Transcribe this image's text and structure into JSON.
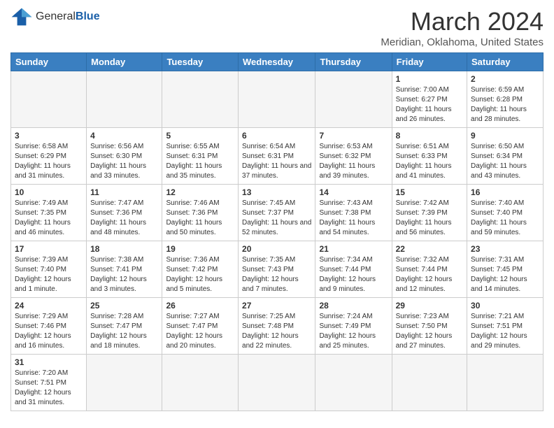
{
  "header": {
    "logo_general": "General",
    "logo_blue": "Blue",
    "month_title": "March 2024",
    "location": "Meridian, Oklahoma, United States"
  },
  "weekdays": [
    "Sunday",
    "Monday",
    "Tuesday",
    "Wednesday",
    "Thursday",
    "Friday",
    "Saturday"
  ],
  "weeks": [
    [
      {
        "day": "",
        "info": ""
      },
      {
        "day": "",
        "info": ""
      },
      {
        "day": "",
        "info": ""
      },
      {
        "day": "",
        "info": ""
      },
      {
        "day": "",
        "info": ""
      },
      {
        "day": "1",
        "info": "Sunrise: 7:00 AM\nSunset: 6:27 PM\nDaylight: 11 hours and 26 minutes."
      },
      {
        "day": "2",
        "info": "Sunrise: 6:59 AM\nSunset: 6:28 PM\nDaylight: 11 hours and 28 minutes."
      }
    ],
    [
      {
        "day": "3",
        "info": "Sunrise: 6:58 AM\nSunset: 6:29 PM\nDaylight: 11 hours and 31 minutes."
      },
      {
        "day": "4",
        "info": "Sunrise: 6:56 AM\nSunset: 6:30 PM\nDaylight: 11 hours and 33 minutes."
      },
      {
        "day": "5",
        "info": "Sunrise: 6:55 AM\nSunset: 6:31 PM\nDaylight: 11 hours and 35 minutes."
      },
      {
        "day": "6",
        "info": "Sunrise: 6:54 AM\nSunset: 6:31 PM\nDaylight: 11 hours and 37 minutes."
      },
      {
        "day": "7",
        "info": "Sunrise: 6:53 AM\nSunset: 6:32 PM\nDaylight: 11 hours and 39 minutes."
      },
      {
        "day": "8",
        "info": "Sunrise: 6:51 AM\nSunset: 6:33 PM\nDaylight: 11 hours and 41 minutes."
      },
      {
        "day": "9",
        "info": "Sunrise: 6:50 AM\nSunset: 6:34 PM\nDaylight: 11 hours and 43 minutes."
      }
    ],
    [
      {
        "day": "10",
        "info": "Sunrise: 7:49 AM\nSunset: 7:35 PM\nDaylight: 11 hours and 46 minutes."
      },
      {
        "day": "11",
        "info": "Sunrise: 7:47 AM\nSunset: 7:36 PM\nDaylight: 11 hours and 48 minutes."
      },
      {
        "day": "12",
        "info": "Sunrise: 7:46 AM\nSunset: 7:36 PM\nDaylight: 11 hours and 50 minutes."
      },
      {
        "day": "13",
        "info": "Sunrise: 7:45 AM\nSunset: 7:37 PM\nDaylight: 11 hours and 52 minutes."
      },
      {
        "day": "14",
        "info": "Sunrise: 7:43 AM\nSunset: 7:38 PM\nDaylight: 11 hours and 54 minutes."
      },
      {
        "day": "15",
        "info": "Sunrise: 7:42 AM\nSunset: 7:39 PM\nDaylight: 11 hours and 56 minutes."
      },
      {
        "day": "16",
        "info": "Sunrise: 7:40 AM\nSunset: 7:40 PM\nDaylight: 11 hours and 59 minutes."
      }
    ],
    [
      {
        "day": "17",
        "info": "Sunrise: 7:39 AM\nSunset: 7:40 PM\nDaylight: 12 hours and 1 minute."
      },
      {
        "day": "18",
        "info": "Sunrise: 7:38 AM\nSunset: 7:41 PM\nDaylight: 12 hours and 3 minutes."
      },
      {
        "day": "19",
        "info": "Sunrise: 7:36 AM\nSunset: 7:42 PM\nDaylight: 12 hours and 5 minutes."
      },
      {
        "day": "20",
        "info": "Sunrise: 7:35 AM\nSunset: 7:43 PM\nDaylight: 12 hours and 7 minutes."
      },
      {
        "day": "21",
        "info": "Sunrise: 7:34 AM\nSunset: 7:44 PM\nDaylight: 12 hours and 9 minutes."
      },
      {
        "day": "22",
        "info": "Sunrise: 7:32 AM\nSunset: 7:44 PM\nDaylight: 12 hours and 12 minutes."
      },
      {
        "day": "23",
        "info": "Sunrise: 7:31 AM\nSunset: 7:45 PM\nDaylight: 12 hours and 14 minutes."
      }
    ],
    [
      {
        "day": "24",
        "info": "Sunrise: 7:29 AM\nSunset: 7:46 PM\nDaylight: 12 hours and 16 minutes."
      },
      {
        "day": "25",
        "info": "Sunrise: 7:28 AM\nSunset: 7:47 PM\nDaylight: 12 hours and 18 minutes."
      },
      {
        "day": "26",
        "info": "Sunrise: 7:27 AM\nSunset: 7:47 PM\nDaylight: 12 hours and 20 minutes."
      },
      {
        "day": "27",
        "info": "Sunrise: 7:25 AM\nSunset: 7:48 PM\nDaylight: 12 hours and 22 minutes."
      },
      {
        "day": "28",
        "info": "Sunrise: 7:24 AM\nSunset: 7:49 PM\nDaylight: 12 hours and 25 minutes."
      },
      {
        "day": "29",
        "info": "Sunrise: 7:23 AM\nSunset: 7:50 PM\nDaylight: 12 hours and 27 minutes."
      },
      {
        "day": "30",
        "info": "Sunrise: 7:21 AM\nSunset: 7:51 PM\nDaylight: 12 hours and 29 minutes."
      }
    ],
    [
      {
        "day": "31",
        "info": "Sunrise: 7:20 AM\nSunset: 7:51 PM\nDaylight: 12 hours and 31 minutes."
      },
      {
        "day": "",
        "info": ""
      },
      {
        "day": "",
        "info": ""
      },
      {
        "day": "",
        "info": ""
      },
      {
        "day": "",
        "info": ""
      },
      {
        "day": "",
        "info": ""
      },
      {
        "day": "",
        "info": ""
      }
    ]
  ]
}
